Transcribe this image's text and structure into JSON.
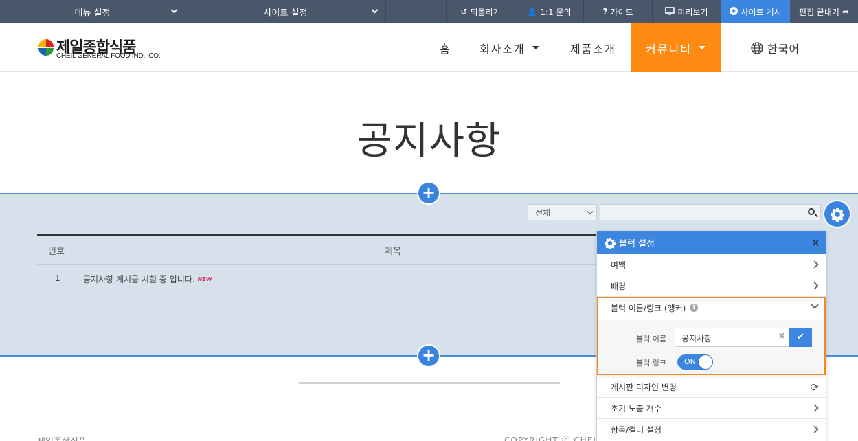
{
  "toolbar": {
    "menu_settings": "메뉴 설정",
    "site_settings": "사이트 설정",
    "undo": "되돌리기",
    "inquiry": "1:1 문의",
    "guide": "가이드",
    "preview": "미리보기",
    "publish": "사이트 게시",
    "exit_edit": "편집 끝내기",
    "colors": {
      "bg": "#4a5669",
      "publish": "#3d86e0"
    }
  },
  "header": {
    "logo_ko": "제일종합식품",
    "logo_en": "CHEIL GENERAL FOOD IND., CO.",
    "nav": {
      "home": "홈",
      "about": "회사소개",
      "products": "제품소개",
      "community": "커뮤니티",
      "language": "한국어"
    },
    "active_color": "#fd8b13"
  },
  "page": {
    "title": "공지사항"
  },
  "board": {
    "filter_value": "전체",
    "search_placeholder": "",
    "columns": {
      "number": "번호",
      "subject": "제목"
    },
    "rows": [
      {
        "number": "1",
        "subject": "공지사항 게시물 시험 중 입니다.",
        "badge": "NEW"
      }
    ]
  },
  "footer": {
    "company": "제일종합식품",
    "copyright": "COPYRIGHT ⓒ CHEIL"
  },
  "block_settings": {
    "title": "블럭 설정",
    "items": {
      "margin": "여백",
      "background": "배경",
      "name_link": "블럭 이름/링크 (앵커)",
      "board_design": "게시판 디자인 변경",
      "initial_count": "초기 노출 개수",
      "item_color": "항목/컬러 설정"
    },
    "block_name_label": "블럭 이름",
    "block_name_value": "공지사항",
    "block_link_label": "블럭 링크",
    "block_link_state": "ON",
    "accent": "#3d86e0",
    "highlight": "#f08a23"
  }
}
